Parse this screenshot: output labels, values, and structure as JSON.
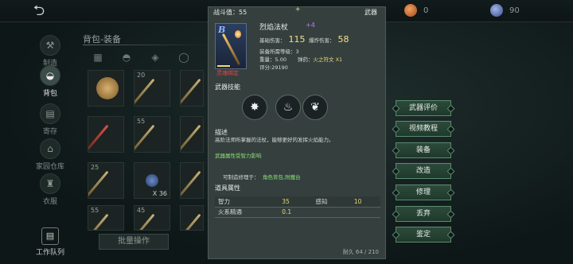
{
  "topbar": {
    "back_icon": "back-arrow-icon",
    "resources": [
      {
        "icon": "gem-icon",
        "value": "0",
        "color": "#e08a4a"
      },
      {
        "icon": "token-icon",
        "value": "90",
        "color": "#6f86c8"
      }
    ]
  },
  "leftnav": {
    "items": [
      {
        "label": "制造",
        "icon": "hammer-icon",
        "active": false
      },
      {
        "label": "背包",
        "icon": "bag-icon",
        "active": true
      },
      {
        "label": "寄存",
        "icon": "deposit-icon",
        "active": false
      },
      {
        "label": "家园仓库",
        "icon": "warehouse-icon",
        "active": false
      },
      {
        "label": "衣服",
        "icon": "clothes-icon",
        "active": false
      }
    ],
    "worker_label": "工作队列"
  },
  "bag": {
    "title": "背包-装备",
    "bulk_label": "批量操作",
    "slots": [
      {
        "count": "",
        "qty": ""
      },
      {
        "count": "20",
        "qty": ""
      },
      {
        "count": "",
        "qty": ""
      },
      {
        "count": "",
        "qty": ""
      },
      {
        "count": "55",
        "qty": ""
      },
      {
        "count": "",
        "qty": ""
      },
      {
        "count": "25",
        "qty": ""
      },
      {
        "count": "",
        "qty": "X 36"
      },
      {
        "count": "",
        "qty": ""
      },
      {
        "count": "55",
        "qty": ""
      },
      {
        "count": "45",
        "qty": ""
      },
      {
        "count": "",
        "qty": ""
      }
    ]
  },
  "detail": {
    "score_label": "战斗值：55",
    "type_label": "武器",
    "rarity": "B",
    "bound": "灵魂绑定",
    "name": "烈焰法杖",
    "level": "+4",
    "base_damage_label": "基础伤害：",
    "base_damage": "115",
    "burst_damage_label": "爆炸伤害：",
    "burst_damage": "58",
    "req_level": "装备所需等级：3",
    "weight_label": "重量：",
    "weight": "5.00",
    "ammo_label": "弹药：",
    "ammo": "火之符文  X1",
    "rating": "评分:29190",
    "skills_title": "武器技能",
    "skills": [
      "fire-burst-icon",
      "flame-icon",
      "fire-claw-icon"
    ],
    "desc_title": "描述",
    "desc_text": "高阶法师所掌握的法杖，能够更好的发挥火焰能力。",
    "influence": "武器属性受智力影响",
    "repair_label": "可制造修理于：",
    "repair_place": "角色背包,附魔台",
    "attr_title": "道具属性",
    "attributes": [
      {
        "k1": "智力",
        "v1": "35",
        "k2": "感知",
        "v2": "10"
      },
      {
        "k1": "火系精通",
        "v1": "0.1",
        "k2": "",
        "v2": ""
      }
    ],
    "durability": "耐久 64 / 210"
  },
  "actions": [
    "武器评价",
    "视频教程",
    "装备",
    "改造",
    "修理",
    "丢弃",
    "鉴定"
  ]
}
